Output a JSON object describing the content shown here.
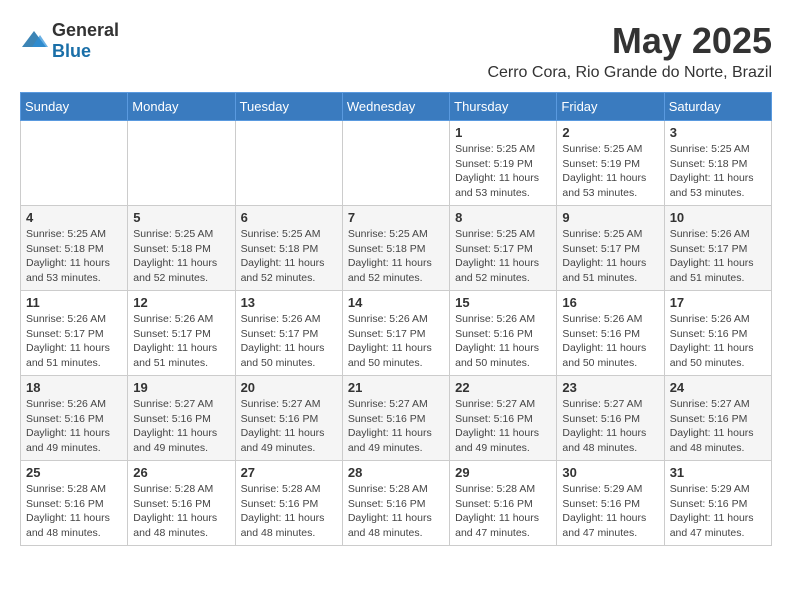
{
  "header": {
    "logo": {
      "text_general": "General",
      "text_blue": "Blue"
    },
    "month_title": "May 2025",
    "location": "Cerro Cora, Rio Grande do Norte, Brazil"
  },
  "weekdays": [
    "Sunday",
    "Monday",
    "Tuesday",
    "Wednesday",
    "Thursday",
    "Friday",
    "Saturday"
  ],
  "weeks": [
    [
      {
        "day": "",
        "info": ""
      },
      {
        "day": "",
        "info": ""
      },
      {
        "day": "",
        "info": ""
      },
      {
        "day": "",
        "info": ""
      },
      {
        "day": "1",
        "info": "Sunrise: 5:25 AM\nSunset: 5:19 PM\nDaylight: 11 hours\nand 53 minutes."
      },
      {
        "day": "2",
        "info": "Sunrise: 5:25 AM\nSunset: 5:19 PM\nDaylight: 11 hours\nand 53 minutes."
      },
      {
        "day": "3",
        "info": "Sunrise: 5:25 AM\nSunset: 5:18 PM\nDaylight: 11 hours\nand 53 minutes."
      }
    ],
    [
      {
        "day": "4",
        "info": "Sunrise: 5:25 AM\nSunset: 5:18 PM\nDaylight: 11 hours\nand 53 minutes."
      },
      {
        "day": "5",
        "info": "Sunrise: 5:25 AM\nSunset: 5:18 PM\nDaylight: 11 hours\nand 52 minutes."
      },
      {
        "day": "6",
        "info": "Sunrise: 5:25 AM\nSunset: 5:18 PM\nDaylight: 11 hours\nand 52 minutes."
      },
      {
        "day": "7",
        "info": "Sunrise: 5:25 AM\nSunset: 5:18 PM\nDaylight: 11 hours\nand 52 minutes."
      },
      {
        "day": "8",
        "info": "Sunrise: 5:25 AM\nSunset: 5:17 PM\nDaylight: 11 hours\nand 52 minutes."
      },
      {
        "day": "9",
        "info": "Sunrise: 5:25 AM\nSunset: 5:17 PM\nDaylight: 11 hours\nand 51 minutes."
      },
      {
        "day": "10",
        "info": "Sunrise: 5:26 AM\nSunset: 5:17 PM\nDaylight: 11 hours\nand 51 minutes."
      }
    ],
    [
      {
        "day": "11",
        "info": "Sunrise: 5:26 AM\nSunset: 5:17 PM\nDaylight: 11 hours\nand 51 minutes."
      },
      {
        "day": "12",
        "info": "Sunrise: 5:26 AM\nSunset: 5:17 PM\nDaylight: 11 hours\nand 51 minutes."
      },
      {
        "day": "13",
        "info": "Sunrise: 5:26 AM\nSunset: 5:17 PM\nDaylight: 11 hours\nand 50 minutes."
      },
      {
        "day": "14",
        "info": "Sunrise: 5:26 AM\nSunset: 5:17 PM\nDaylight: 11 hours\nand 50 minutes."
      },
      {
        "day": "15",
        "info": "Sunrise: 5:26 AM\nSunset: 5:16 PM\nDaylight: 11 hours\nand 50 minutes."
      },
      {
        "day": "16",
        "info": "Sunrise: 5:26 AM\nSunset: 5:16 PM\nDaylight: 11 hours\nand 50 minutes."
      },
      {
        "day": "17",
        "info": "Sunrise: 5:26 AM\nSunset: 5:16 PM\nDaylight: 11 hours\nand 50 minutes."
      }
    ],
    [
      {
        "day": "18",
        "info": "Sunrise: 5:26 AM\nSunset: 5:16 PM\nDaylight: 11 hours\nand 49 minutes."
      },
      {
        "day": "19",
        "info": "Sunrise: 5:27 AM\nSunset: 5:16 PM\nDaylight: 11 hours\nand 49 minutes."
      },
      {
        "day": "20",
        "info": "Sunrise: 5:27 AM\nSunset: 5:16 PM\nDaylight: 11 hours\nand 49 minutes."
      },
      {
        "day": "21",
        "info": "Sunrise: 5:27 AM\nSunset: 5:16 PM\nDaylight: 11 hours\nand 49 minutes."
      },
      {
        "day": "22",
        "info": "Sunrise: 5:27 AM\nSunset: 5:16 PM\nDaylight: 11 hours\nand 49 minutes."
      },
      {
        "day": "23",
        "info": "Sunrise: 5:27 AM\nSunset: 5:16 PM\nDaylight: 11 hours\nand 48 minutes."
      },
      {
        "day": "24",
        "info": "Sunrise: 5:27 AM\nSunset: 5:16 PM\nDaylight: 11 hours\nand 48 minutes."
      }
    ],
    [
      {
        "day": "25",
        "info": "Sunrise: 5:28 AM\nSunset: 5:16 PM\nDaylight: 11 hours\nand 48 minutes."
      },
      {
        "day": "26",
        "info": "Sunrise: 5:28 AM\nSunset: 5:16 PM\nDaylight: 11 hours\nand 48 minutes."
      },
      {
        "day": "27",
        "info": "Sunrise: 5:28 AM\nSunset: 5:16 PM\nDaylight: 11 hours\nand 48 minutes."
      },
      {
        "day": "28",
        "info": "Sunrise: 5:28 AM\nSunset: 5:16 PM\nDaylight: 11 hours\nand 48 minutes."
      },
      {
        "day": "29",
        "info": "Sunrise: 5:28 AM\nSunset: 5:16 PM\nDaylight: 11 hours\nand 47 minutes."
      },
      {
        "day": "30",
        "info": "Sunrise: 5:29 AM\nSunset: 5:16 PM\nDaylight: 11 hours\nand 47 minutes."
      },
      {
        "day": "31",
        "info": "Sunrise: 5:29 AM\nSunset: 5:16 PM\nDaylight: 11 hours\nand 47 minutes."
      }
    ]
  ]
}
